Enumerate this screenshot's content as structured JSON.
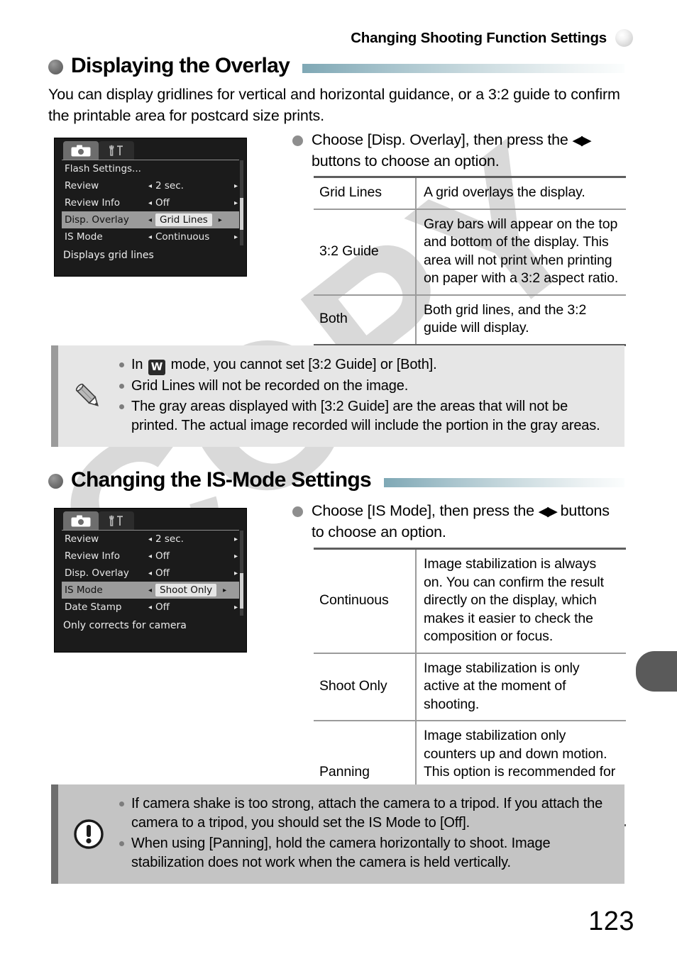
{
  "watermark": {
    "text": "COPY"
  },
  "header": {
    "running_title": "Changing Shooting Function Settings",
    "sphere_icon": "gray-sphere-icon"
  },
  "folio": {
    "page_number": "123"
  },
  "edge_tab": {
    "name": "chapter-thumb-tab"
  },
  "sections": [
    {
      "id": "displaying-the-overlay",
      "heading": "Displaying the Overlay",
      "intro": "You can display gridlines for vertical and horizontal guidance, or a 3:2 guide to confirm the printable area for postcard size prints.",
      "step": {
        "text_before": "Choose [Disp. Overlay], then press the ",
        "arrows": "◀▶",
        "text_after": " buttons to choose an option."
      },
      "lcd": {
        "tabs": [
          {
            "icon": "camera-icon",
            "state": "active"
          },
          {
            "icon": "wrench-tools-icon",
            "state": "inactive"
          }
        ],
        "rows": [
          {
            "label": "Flash Settings...",
            "value": "",
            "selected": false,
            "has_arrows": false
          },
          {
            "label": "Review",
            "value": "2 sec.",
            "selected": false,
            "has_arrows": true
          },
          {
            "label": "Review Info",
            "value": "Off",
            "selected": false,
            "has_arrows": true
          },
          {
            "label": "Disp. Overlay",
            "value": "Grid Lines",
            "selected": true,
            "has_arrows": true
          },
          {
            "label": "IS Mode",
            "value": "Continuous",
            "selected": false,
            "has_arrows": true
          }
        ],
        "hint": "Displays grid lines"
      },
      "table": {
        "rows": [
          {
            "option": "Grid Lines",
            "description": "A grid overlays the display."
          },
          {
            "option": "3:2 Guide",
            "description": "Gray bars will appear on the top and bottom of the display. This area will not print when printing on paper with a 3:2 aspect ratio."
          },
          {
            "option": "Both",
            "description": "Both grid lines, and the 3:2 guide will display."
          }
        ]
      },
      "callout": {
        "kind": "note",
        "icon": "pencil-icon",
        "bullets": [
          {
            "pre": "In ",
            "badge": "W",
            "post": " mode, you cannot set [3:2 Guide] or [Both]."
          },
          {
            "pre": "Grid Lines will not be recorded on the image.",
            "badge": "",
            "post": ""
          },
          {
            "pre": "The gray areas displayed with [3:2 Guide] are the areas that will not be printed. The actual image recorded will include the portion in the gray areas.",
            "badge": "",
            "post": ""
          }
        ]
      }
    },
    {
      "id": "changing-the-is-mode-settings",
      "heading": "Changing the IS-Mode Settings",
      "intro": "",
      "step": {
        "text_before": "Choose [IS Mode], then press the ",
        "arrows": "◀▶",
        "text_after": " buttons to choose an option."
      },
      "lcd": {
        "tabs": [
          {
            "icon": "camera-icon",
            "state": "active"
          },
          {
            "icon": "wrench-tools-icon",
            "state": "inactive"
          }
        ],
        "rows": [
          {
            "label": "Review",
            "value": "2 sec.",
            "selected": false,
            "has_arrows": true
          },
          {
            "label": "Review Info",
            "value": "Off",
            "selected": false,
            "has_arrows": true
          },
          {
            "label": "Disp. Overlay",
            "value": "Off",
            "selected": false,
            "has_arrows": true
          },
          {
            "label": "IS Mode",
            "value": "Shoot Only",
            "selected": true,
            "has_arrows": true
          },
          {
            "label": "Date Stamp",
            "value": "Off",
            "selected": false,
            "has_arrows": true
          }
        ],
        "hint": "Only corrects for camera"
      },
      "table": {
        "rows": [
          {
            "option": "Continuous",
            "description": "Image stabilization is always on. You can confirm the result directly on the display, which makes it easier to check the composition or focus."
          },
          {
            "option": "Shoot Only",
            "description": "Image stabilization is only active at the moment of shooting."
          },
          {
            "option": "Panning",
            "description": "Image stabilization only counters up and down motion. This option is recommended for shooting objects moving horizontally."
          }
        ]
      },
      "callout": {
        "kind": "warn",
        "icon": "exclamation-circle-icon",
        "bullets": [
          {
            "pre": "If camera shake is too strong, attach the camera to a tripod. If you attach the camera to a tripod, you should set the IS Mode to [Off].",
            "badge": "",
            "post": ""
          },
          {
            "pre": "When using [Panning], hold the camera horizontally to shoot. Image stabilization does not work when the camera is held vertically.",
            "badge": "",
            "post": ""
          }
        ]
      }
    }
  ],
  "colors": {
    "heading_rule_start": "#7fa8b5",
    "note_background": "#e6e6e6",
    "warn_background": "#c4c4c4",
    "lcd_background": "#1b1b1b",
    "edge_tab": "#5a5a5a",
    "watermark": "#d9d9d9"
  }
}
